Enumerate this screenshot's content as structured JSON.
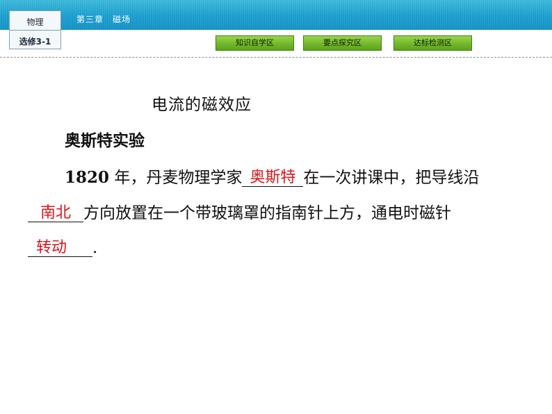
{
  "header": {
    "subject": "物理",
    "module": "选修3-1",
    "chapter": "第三章　磁场",
    "nav": [
      "知识自学区",
      "要点探究区",
      "达标检测区"
    ],
    "colors": {
      "bar": "#179ccd",
      "nav_green": "#6fb628",
      "answer_red": "#d8141b"
    }
  },
  "content": {
    "heading": "电流的磁效应",
    "section": "奥斯特实验",
    "line1": {
      "year": "1820",
      "before": "年，丹麦物理学家",
      "answer1": "奥斯特",
      "after": "在一次讲课中，把导线沿"
    },
    "line2": {
      "answer2": "南北",
      "after": "方向放置在一个带玻璃罩的指南针上方，通电时磁针"
    },
    "line3": {
      "answer3": "转动",
      "after": "."
    }
  }
}
